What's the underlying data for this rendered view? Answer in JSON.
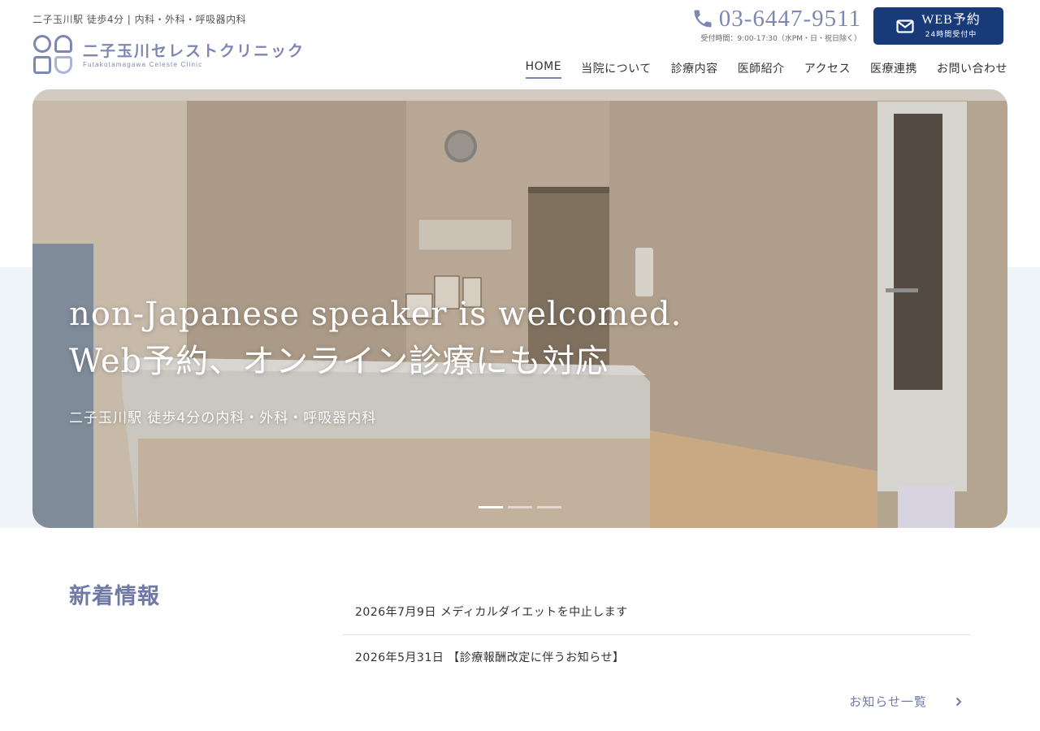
{
  "header": {
    "tagline": "二子玉川駅 徒歩4分 | 内科・外科・呼吸器内科",
    "logo_jp": "二子玉川セレストクリニック",
    "logo_en": "Futakotamagawa Celeste Clinic",
    "phone_number": "03-6447-9511",
    "phone_hours": "受付時間：9:00-17:30（水PM・日・祝日除く）",
    "web_button_main": "WEB予約",
    "web_button_sub": "24時間受付中"
  },
  "nav": {
    "items": [
      {
        "label": "HOME",
        "active": true
      },
      {
        "label": "当院について"
      },
      {
        "label": "診療内容"
      },
      {
        "label": "医師紹介"
      },
      {
        "label": "アクセス"
      },
      {
        "label": "医療連携"
      },
      {
        "label": "お問い合わせ"
      }
    ]
  },
  "hero": {
    "title_line1": "non-Japanese speaker is welcomed.",
    "title_line2": "Web予約、オンライン診療にも対応",
    "subtitle": "二子玉川駅 徒歩4分の内科・外科・呼吸器内科",
    "slides_count": 3,
    "active_slide": 1
  },
  "news": {
    "heading": "新着情報",
    "items": [
      "2026年7月9日 メディカルダイエットを中止します",
      "2026年5月31日 【診療報酬改定に伴うお知らせ】"
    ],
    "more_label": "お知らせ一覧"
  },
  "colors": {
    "brand": "#7d87b3",
    "button": "#183a78",
    "band": "#eef4f8"
  }
}
